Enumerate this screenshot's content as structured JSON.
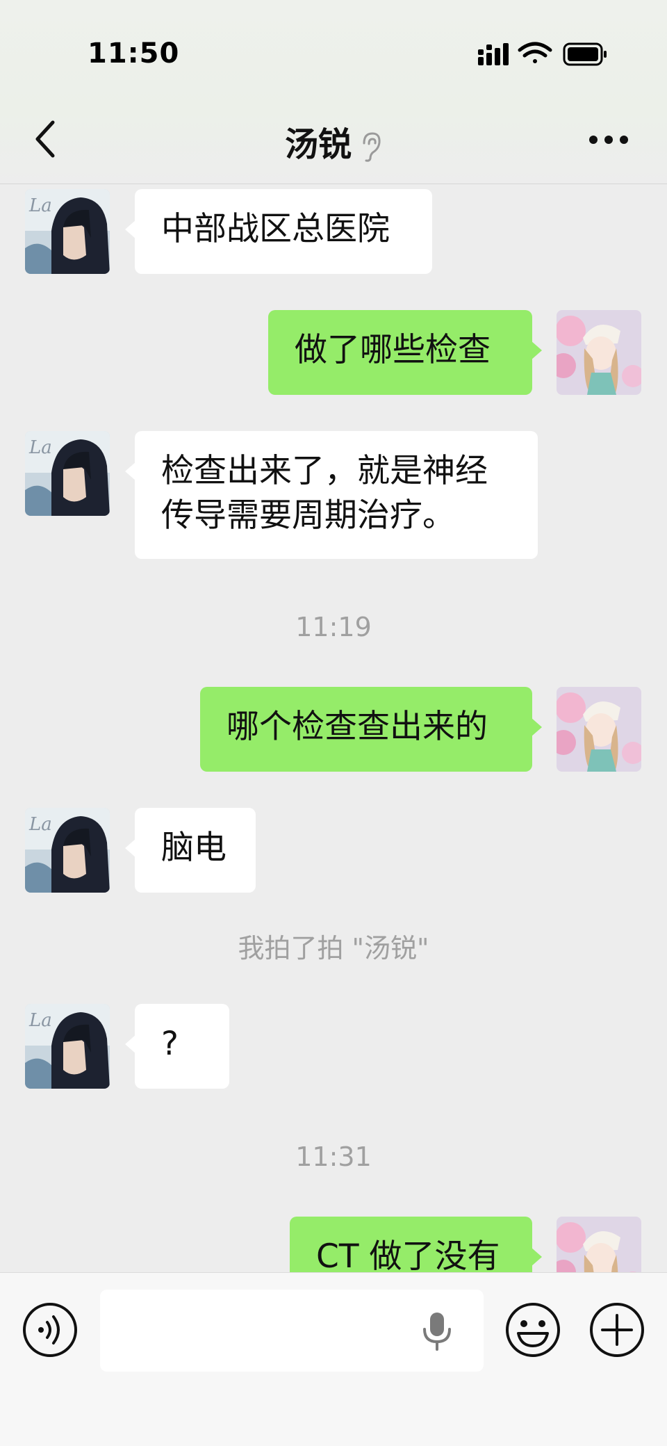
{
  "status_bar": {
    "time": "11:50"
  },
  "header": {
    "title": "汤锐"
  },
  "messages": [
    {
      "side": "in",
      "text": "中部战区总医院"
    },
    {
      "side": "out",
      "text": "做了哪些检查"
    },
    {
      "side": "in",
      "text": "检查出来了，就是神经\n传导需要周期治疗。"
    },
    {
      "side": "system",
      "text": "11:19"
    },
    {
      "side": "out",
      "text": "哪个检查查出来的"
    },
    {
      "side": "in",
      "text": "脑电"
    },
    {
      "side": "system",
      "text": "我拍了拍 \"汤锐\""
    },
    {
      "side": "in",
      "text": "?"
    },
    {
      "side": "system",
      "text": "11:31"
    },
    {
      "side": "out",
      "text": "CT 做了没有"
    }
  ],
  "input": {
    "value": "",
    "placeholder": ""
  },
  "colors": {
    "outgoing_bubble": "#95ec69",
    "incoming_bubble": "#ffffff",
    "background": "#ededed"
  },
  "icons": [
    "back-icon",
    "ear-icon",
    "more-icon",
    "voice-icon",
    "mic-icon",
    "emoji-icon",
    "plus-icon"
  ]
}
